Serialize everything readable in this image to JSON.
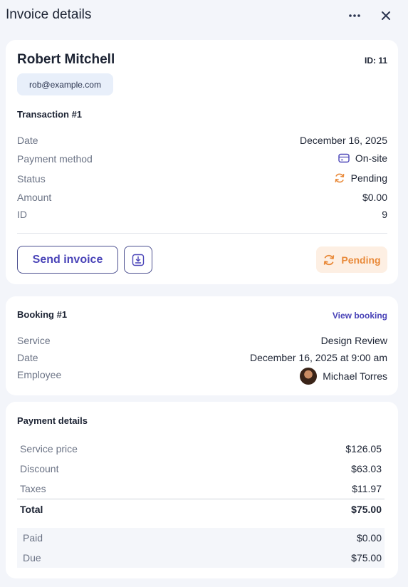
{
  "header": {
    "title": "Invoice details",
    "more_icon": "more-horizontal-icon",
    "close_icon": "close-icon"
  },
  "customer": {
    "name": "Robert Mitchell",
    "id_label": "ID: 11",
    "email": "rob@example.com"
  },
  "transaction": {
    "title": "Transaction #1",
    "rows": [
      {
        "label": "Date",
        "value": "December 16, 2025"
      },
      {
        "label": "Payment method",
        "value": "On-site"
      },
      {
        "label": "Status",
        "value": "Pending"
      },
      {
        "label": "Amount",
        "value": "$0.00"
      },
      {
        "label": "ID",
        "value": "9"
      }
    ],
    "send_invoice_label": "Send invoice",
    "status_badge": "Pending"
  },
  "booking": {
    "title": "Booking #1",
    "view_link": "View booking",
    "rows": [
      {
        "label": "Service",
        "value": "Design Review"
      },
      {
        "label": "Date",
        "value": "December 16, 2025 at 9:00 am"
      },
      {
        "label": "Employee",
        "value": "Michael Torres"
      }
    ]
  },
  "payment": {
    "title": "Payment details",
    "rows": [
      {
        "label": "Service price",
        "value": "$126.05"
      },
      {
        "label": "Discount",
        "value": "$63.03"
      },
      {
        "label": "Taxes",
        "value": "$11.97"
      }
    ],
    "total": {
      "label": "Total",
      "value": "$75.00"
    },
    "summary": [
      {
        "label": "Paid",
        "value": "$0.00"
      },
      {
        "label": "Due",
        "value": "$75.00"
      }
    ]
  },
  "colors": {
    "accent": "#4a44b8",
    "pending": "#e98a3a",
    "pending_bg": "#fdefe3",
    "background": "#f3f5fa"
  }
}
